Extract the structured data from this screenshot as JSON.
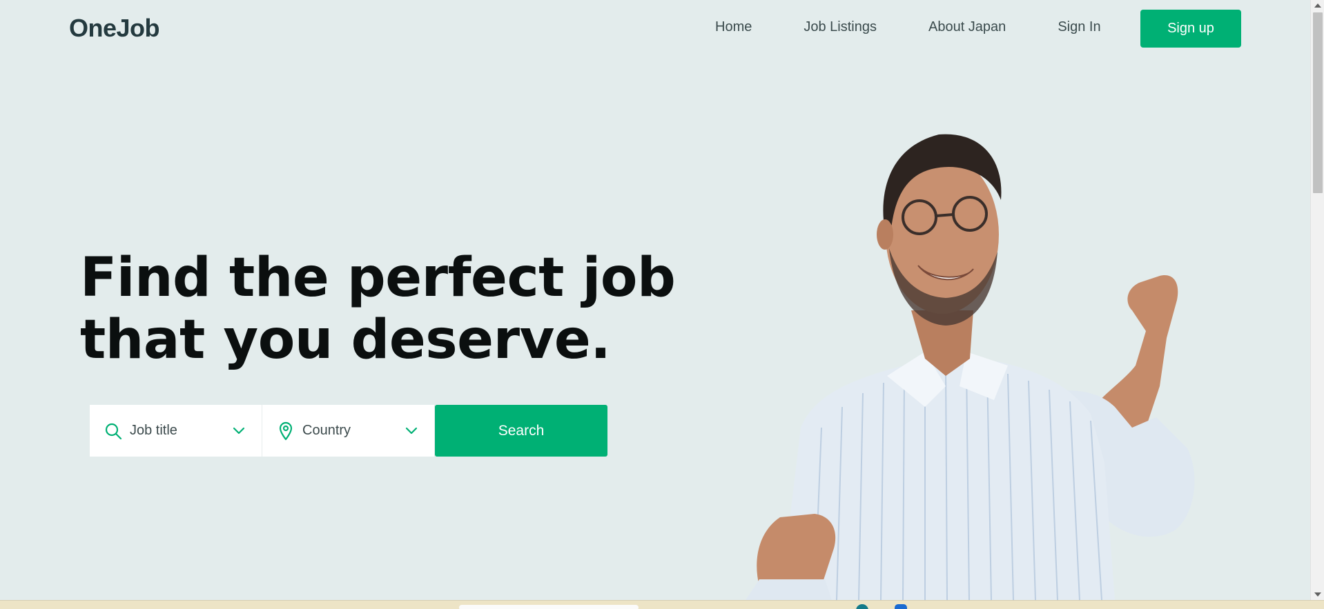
{
  "header": {
    "brand": "OneJob",
    "nav": [
      "Home",
      "Job Listings",
      "About Japan",
      "Sign In"
    ],
    "signup_label": "Sign up"
  },
  "hero": {
    "headline_line1": "Find the perfect job",
    "headline_line2": "that you deserve."
  },
  "search": {
    "job_title_label": "Job title",
    "country_label": "Country",
    "button_label": "Search"
  },
  "icons": {
    "job_field": "search-icon",
    "country_field": "map-pin-icon",
    "dropdown": "chevron-down-icon"
  },
  "colors": {
    "accent": "#00b074",
    "background": "#e3ecec",
    "headline": "#0b0f0f",
    "brand": "#243a3f"
  }
}
